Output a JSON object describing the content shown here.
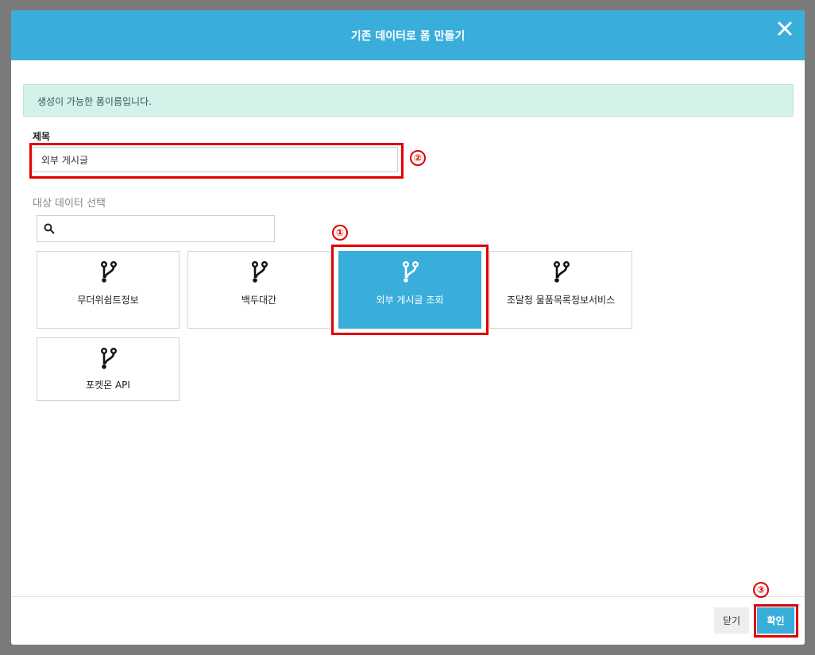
{
  "dialog": {
    "title": "기존 데이터로 폼 만들기",
    "close_icon": "close-icon"
  },
  "alert": {
    "text": "생성이 가능한 폼이름입니다."
  },
  "form": {
    "title_label": "제목",
    "title_value": "외부 게시글",
    "section_label": "대상 데이터 선택",
    "search_placeholder": "",
    "search_icon": "search-icon"
  },
  "sources": [
    {
      "label": "무더위쉼트정보",
      "icon": "git-branch-icon",
      "selected": false
    },
    {
      "label": "백두대간",
      "icon": "git-branch-icon",
      "selected": false
    },
    {
      "label": "외부 게시글 조회",
      "icon": "git-branch-icon",
      "selected": true
    },
    {
      "label": "조달청 물품목록정보서비스",
      "icon": "git-branch-icon",
      "selected": false
    },
    {
      "label": "포켓몬 API",
      "icon": "git-branch-icon",
      "selected": false
    }
  ],
  "annotations": [
    "①",
    "②",
    "③"
  ],
  "footer": {
    "close_label": "닫기",
    "confirm_label": "확인"
  },
  "colors": {
    "accent": "#3aaedb",
    "alert_bg": "#d4f1ea",
    "annotation_red": "#e00000"
  }
}
